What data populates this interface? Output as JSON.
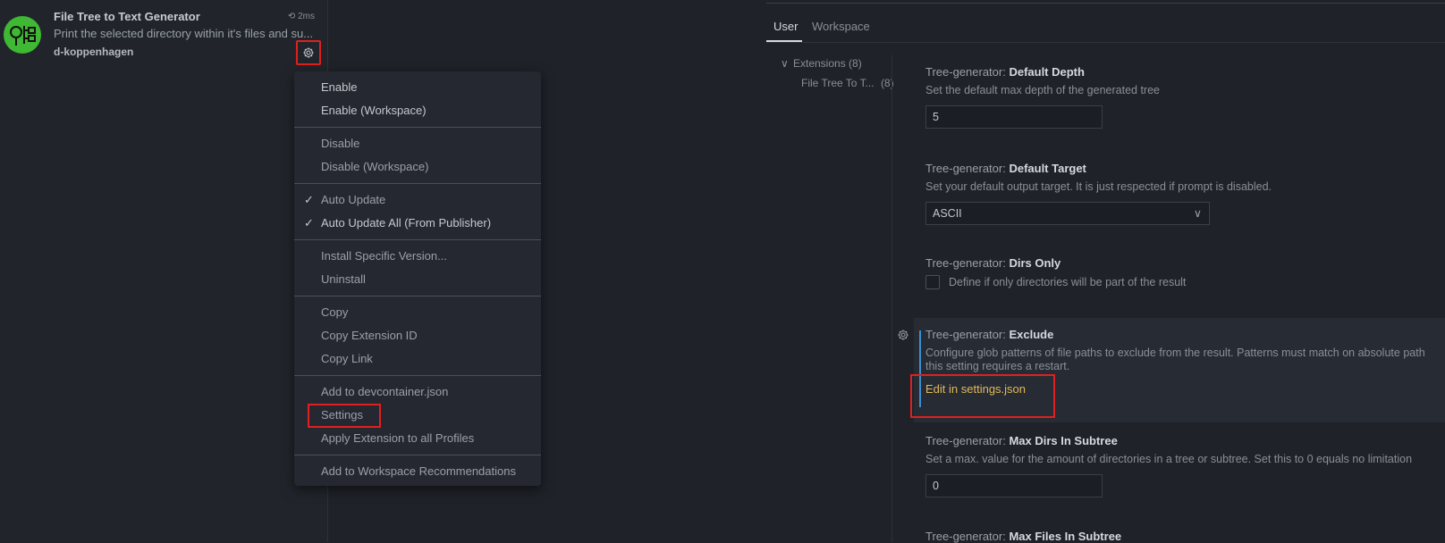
{
  "extension": {
    "title": "File Tree to Text Generator",
    "time": "2ms",
    "description": "Print the selected directory within it's files and su...",
    "publisher": "d-koppenhagen"
  },
  "menu": {
    "groups": [
      [
        {
          "label": "Enable"
        },
        {
          "label": "Enable (Workspace)"
        }
      ],
      [
        {
          "label": "Disable",
          "dim": true
        },
        {
          "label": "Disable (Workspace)",
          "dim": true
        }
      ],
      [
        {
          "label": "Auto Update",
          "checked": true,
          "dim": true
        },
        {
          "label": "Auto Update All (From Publisher)",
          "checked": true
        }
      ],
      [
        {
          "label": "Install Specific Version...",
          "dim": true
        },
        {
          "label": "Uninstall",
          "dim": true
        }
      ],
      [
        {
          "label": "Copy",
          "dim": true
        },
        {
          "label": "Copy Extension ID",
          "dim": true
        },
        {
          "label": "Copy Link",
          "dim": true
        }
      ],
      [
        {
          "label": "Add to devcontainer.json",
          "dim": true
        },
        {
          "label": "Settings",
          "dim": true
        },
        {
          "label": "Apply Extension to all Profiles",
          "dim": true
        }
      ],
      [
        {
          "label": "Add to Workspace Recommendations",
          "dim": true
        }
      ]
    ]
  },
  "tabs": {
    "user": "User",
    "workspace": "Workspace"
  },
  "toc": {
    "extensions": "Extensions (8)",
    "file_tree": "File Tree To T...",
    "file_tree_count": "(8)"
  },
  "settings": {
    "default_depth": {
      "prefix": "Tree-generator: ",
      "name": "Default Depth",
      "desc": "Set the default max depth of the generated tree",
      "value": "5"
    },
    "default_target": {
      "prefix": "Tree-generator: ",
      "name": "Default Target",
      "desc": "Set your default output target. It is just respected if prompt is disabled.",
      "value": "ASCII"
    },
    "dirs_only": {
      "prefix": "Tree-generator: ",
      "name": "Dirs Only",
      "desc": "Define if only directories will be part of the result"
    },
    "exclude": {
      "prefix": "Tree-generator: ",
      "name": "Exclude",
      "desc": "Configure glob patterns of file paths to exclude from the result. Patterns must match on absolute path",
      "desc2": "this setting requires a restart.",
      "link": "Edit in settings.json"
    },
    "max_dirs": {
      "prefix": "Tree-generator: ",
      "name": "Max Dirs In Subtree",
      "desc": "Set a max. value for the amount of directories in a tree or subtree. Set this to 0 equals no limitation",
      "value": "0"
    },
    "max_files": {
      "prefix": "Tree-generator: ",
      "name": "Max Files In Subtree"
    }
  }
}
